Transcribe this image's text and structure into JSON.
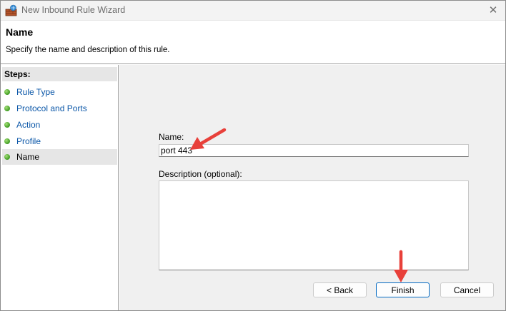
{
  "window": {
    "title": "New Inbound Rule Wizard",
    "close_glyph": "✕"
  },
  "header": {
    "title": "Name",
    "subtitle": "Specify the name and description of this rule."
  },
  "steps": {
    "heading": "Steps:",
    "items": [
      {
        "label": "Rule Type"
      },
      {
        "label": "Protocol and Ports"
      },
      {
        "label": "Action"
      },
      {
        "label": "Profile"
      },
      {
        "label": "Name"
      }
    ],
    "selected": "Name"
  },
  "form": {
    "name_label": "Name:",
    "name_value": "port 443",
    "description_label": "Description (optional):",
    "description_value": ""
  },
  "buttons": {
    "back": "< Back",
    "finish": "Finish",
    "cancel": "Cancel"
  },
  "colors": {
    "annotation_arrow": "#e8403a",
    "default_button_border": "#0067c0",
    "step_link": "#0b57a8"
  }
}
